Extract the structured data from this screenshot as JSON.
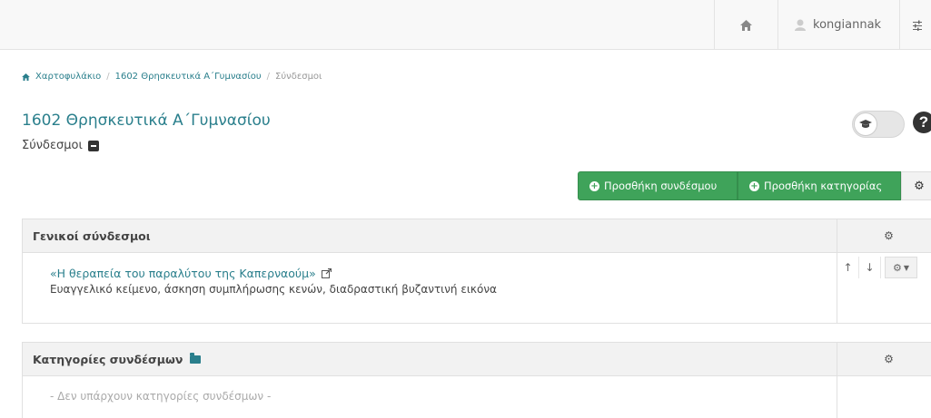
{
  "navbar": {
    "home_icon": "home-icon",
    "user_icon": "user-icon",
    "username": "kongiannak",
    "menu_icon": "sliders-icon"
  },
  "breadcrumb": {
    "items": [
      "Χαρτοφυλάκιο",
      "1602 Θρησκευτικά Α΄Γυμνασίου",
      "Σύνδεσμοι"
    ],
    "separator": "/"
  },
  "page": {
    "title": "1602 Θρησκευτικά Α΄Γυμνασίου",
    "subtitle": "Σύνδεσμοι"
  },
  "actions": {
    "add_link": "Προσθήκη συνδέσμου",
    "add_category": "Προσθήκη κατηγορίας"
  },
  "general_links": {
    "heading": "Γενικοί σύνδεσμοι",
    "items": [
      {
        "title": "«Η θεραπεία του παραλύτου της Καπερναούμ»",
        "description": "Ευαγγελικό κείμενο, άσκηση συμπλήρωσης κενών, διαδραστική βυζαντινή εικόνα"
      }
    ]
  },
  "categories": {
    "heading": "Κατηγορίες συνδέσμων",
    "empty_text": "- Δεν υπάρχουν κατηγορίες συνδέσμων -"
  },
  "colors": {
    "accent": "#2a7f8c",
    "button_green": "#3fa35a"
  }
}
